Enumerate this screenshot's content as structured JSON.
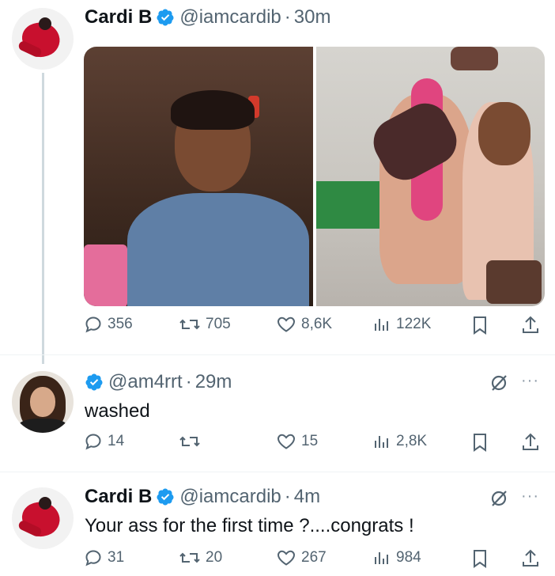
{
  "tweets": [
    {
      "name": "Cardi B",
      "handle": "@iamcardib",
      "dot": "·",
      "time": "30m",
      "verified": true,
      "stats": {
        "replies": "356",
        "retweets": "705",
        "likes": "8,6K",
        "views": "122K"
      }
    },
    {
      "handle": "@am4rrt",
      "dot": "·",
      "time": "29m",
      "verified": true,
      "text": "washed",
      "stats": {
        "replies": "14",
        "retweets": "",
        "likes": "15",
        "views": "2,8K"
      }
    },
    {
      "name": "Cardi B",
      "handle": "@iamcardib",
      "dot": "·",
      "time": "4m",
      "verified": true,
      "text": "Your ass for the first time ?....congrats !",
      "stats": {
        "replies": "31",
        "retweets": "20",
        "likes": "267",
        "views": "984"
      }
    }
  ],
  "more_label": "···",
  "colors": {
    "verified": "#1d9bf0",
    "muted": "#536471",
    "text": "#0f1419",
    "thread_line": "#cfd9de"
  },
  "icons": [
    "reply-icon",
    "retweet-icon",
    "like-icon",
    "views-icon",
    "bookmark-icon",
    "share-icon",
    "grok-icon",
    "more-icon",
    "verified-badge-icon"
  ]
}
